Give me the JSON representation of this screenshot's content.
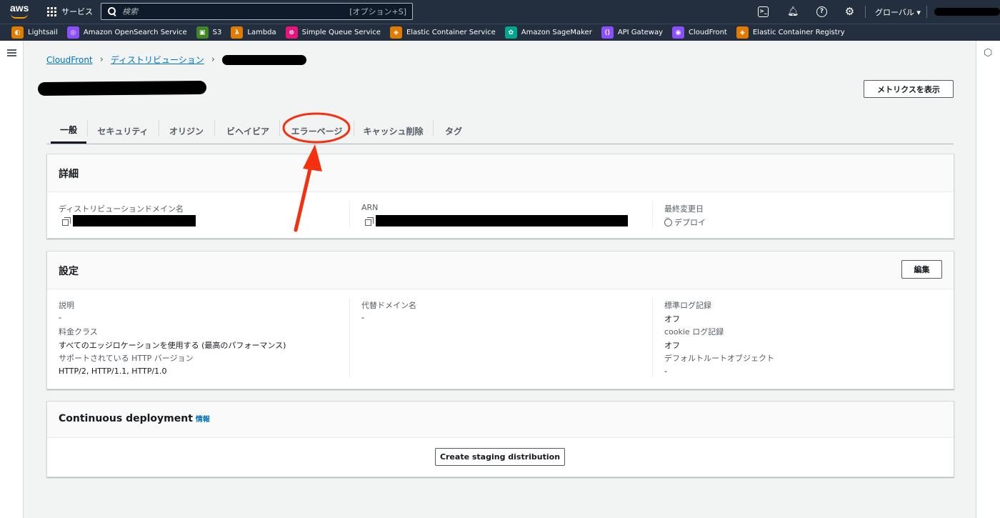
{
  "topbar": {
    "logo": "aws",
    "services_label": "サービス",
    "search_placeholder": "検索",
    "search_shortcut": "[オプション+S]",
    "region": "グローバル ▾"
  },
  "favorites": [
    {
      "label": "Lightsail",
      "color": "#e07b00",
      "glyph": "◐"
    },
    {
      "label": "Amazon OpenSearch Service",
      "color": "#8c4fff",
      "glyph": "◎"
    },
    {
      "label": "S3",
      "color": "#3f8624",
      "glyph": "▣"
    },
    {
      "label": "Lambda",
      "color": "#e07b00",
      "glyph": "λ"
    },
    {
      "label": "Simple Queue Service",
      "color": "#e7157b",
      "glyph": "⊜"
    },
    {
      "label": "Elastic Container Service",
      "color": "#e07b00",
      "glyph": "◈"
    },
    {
      "label": "Amazon SageMaker",
      "color": "#01a88d",
      "glyph": "✿"
    },
    {
      "label": "API Gateway",
      "color": "#8c4fff",
      "glyph": "⟨⟩"
    },
    {
      "label": "CloudFront",
      "color": "#8c4fff",
      "glyph": "◉"
    },
    {
      "label": "Elastic Container Registry",
      "color": "#e07b00",
      "glyph": "◈"
    }
  ],
  "breadcrumb": {
    "root": "CloudFront",
    "section": "ディストリビューション"
  },
  "actions": {
    "metrics": "メトリクスを表示",
    "edit": "編集",
    "staging": "Create staging distribution"
  },
  "tabs": [
    {
      "label": "一般",
      "active": true
    },
    {
      "label": "セキュリティ",
      "active": false
    },
    {
      "label": "オリジン",
      "active": false
    },
    {
      "label": "ビヘイビア",
      "active": false
    },
    {
      "label": "エラーページ",
      "active": false
    },
    {
      "label": "キャッシュ削除",
      "active": false
    },
    {
      "label": "タグ",
      "active": false
    }
  ],
  "details": {
    "title": "詳細",
    "domain_label": "ディストリビューションドメイン名",
    "arn_label": "ARN",
    "modified_label": "最終変更日",
    "modified_value": "デプロイ"
  },
  "settings": {
    "title": "設定",
    "desc_label": "説明",
    "desc_value": "-",
    "price_label": "料金クラス",
    "price_value": "すべてのエッジロケーションを使用する (最高のパフォーマンス)",
    "http_label": "サポートされている HTTP バージョン",
    "http_value": "HTTP/2, HTTP/1.1, HTTP/1.0",
    "alt_label": "代替ドメイン名",
    "alt_value": "-",
    "log_label": "標準ログ記録",
    "log_value": "オフ",
    "cookie_label": "cookie ログ記録",
    "cookie_value": "オフ",
    "root_label": "デフォルトルートオブジェクト",
    "root_value": "-"
  },
  "continuous": {
    "title": "Continuous deployment",
    "info": "情報"
  },
  "colors": {
    "nav_bg": "#232f3e",
    "link": "#0073bb",
    "annotation": "#f4300f"
  }
}
